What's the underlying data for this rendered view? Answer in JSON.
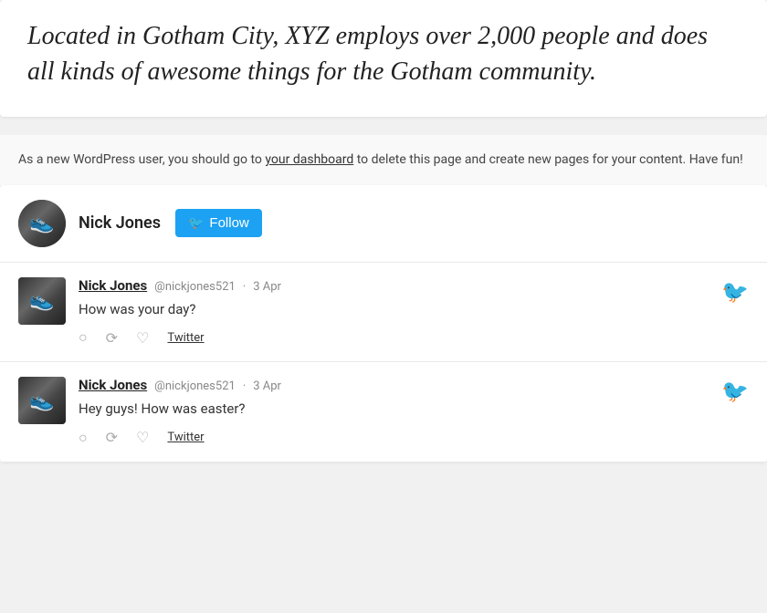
{
  "quote": {
    "text": "Located in Gotham City, XYZ employs over 2,000 people and does all kinds of awesome things for the Gotham community."
  },
  "wp_note": {
    "text_before": "As a new WordPress user, you should go to ",
    "link_text": "your dashboard",
    "text_after": " to delete this page and create new pages for your content. Have fun!"
  },
  "twitter": {
    "header": {
      "user_name": "Nick Jones",
      "follow_label": "Follow"
    },
    "tweets": [
      {
        "username": "Nick Jones",
        "handle": "@nickjones521",
        "date": "3 Apr",
        "text": "How was your day?",
        "link_label": "Twitter"
      },
      {
        "username": "Nick Jones",
        "handle": "@nickjones521",
        "date": "3 Apr",
        "text": "Hey guys! How was easter?",
        "link_label": "Twitter"
      }
    ]
  }
}
